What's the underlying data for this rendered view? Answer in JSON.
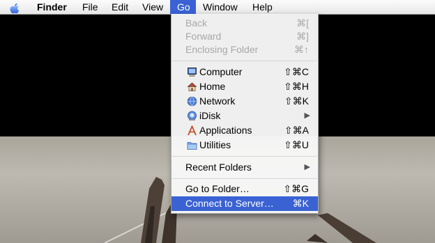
{
  "menubar": {
    "items": [
      {
        "label": "Finder"
      },
      {
        "label": "File"
      },
      {
        "label": "Edit"
      },
      {
        "label": "View"
      },
      {
        "label": "Go"
      },
      {
        "label": "Window"
      },
      {
        "label": "Help"
      }
    ]
  },
  "go_menu": {
    "back": {
      "label": "Back",
      "shortcut": "⌘["
    },
    "forward": {
      "label": "Forward",
      "shortcut": "⌘]"
    },
    "enclosing": {
      "label": "Enclosing Folder",
      "shortcut": "⌘↑"
    },
    "computer": {
      "label": "Computer",
      "shortcut": "⇧⌘C"
    },
    "home": {
      "label": "Home",
      "shortcut": "⇧⌘H"
    },
    "network": {
      "label": "Network",
      "shortcut": "⇧⌘K"
    },
    "idisk": {
      "label": "iDisk",
      "submenu_arrow": "▶"
    },
    "applications": {
      "label": "Applications",
      "shortcut": "⇧⌘A"
    },
    "utilities": {
      "label": "Utilities",
      "shortcut": "⇧⌘U"
    },
    "recent": {
      "label": "Recent Folders",
      "submenu_arrow": "▶"
    },
    "goto": {
      "label": "Go to Folder…",
      "shortcut": "⇧⌘G"
    },
    "connect": {
      "label": "Connect to Server…",
      "shortcut": "⌘K"
    }
  },
  "colors": {
    "selection": "#3a62d3",
    "menubar": "#f1f1f1",
    "disabled_text": "#a8a8a8"
  }
}
